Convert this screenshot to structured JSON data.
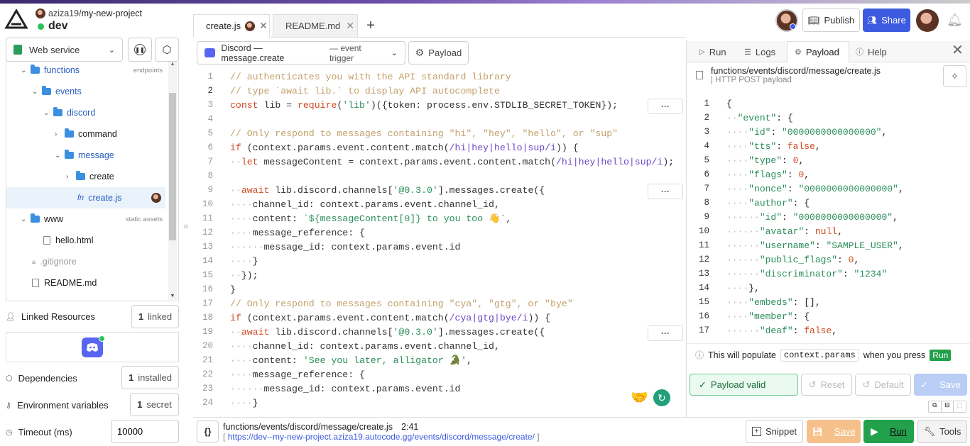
{
  "project": {
    "user": "aziza19",
    "name": "my-new-project",
    "path_sep": "/",
    "env": "dev"
  },
  "header": {
    "publish_label": "Publish",
    "share_label": "Share"
  },
  "sidebar": {
    "service_select": "Web service",
    "tree": {
      "functions": "functions",
      "functions_tag": "endpoints",
      "events": "events",
      "discord": "discord",
      "command": "command",
      "message": "message",
      "create_folder": "create",
      "create_file": "create.js",
      "www": "www",
      "www_tag": "static assets",
      "hello": "hello.html",
      "gitignore": ".gitignore",
      "readme": "README.md"
    },
    "linked_resources_label": "Linked Resources",
    "linked_count": "1",
    "linked_suffix": "linked",
    "dependencies_label": "Dependencies",
    "dep_count": "1",
    "dep_suffix": "installed",
    "env_label": "Environment variables",
    "env_count": "1",
    "env_suffix": "secret",
    "timeout_label": "Timeout (ms)",
    "timeout_value": "10000"
  },
  "tabs": [
    {
      "label": "create.js"
    },
    {
      "label": "README.md"
    }
  ],
  "trigger": {
    "name": "Discord — message.create",
    "kind": "— event trigger",
    "payload_label": "Payload"
  },
  "code": [
    {
      "n": "1",
      "t": "// authenticates you with the API standard library"
    },
    {
      "n": "2",
      "t": "// type `await lib.` to display API autocomplete"
    },
    {
      "n": "3",
      "t": "const lib = require('lib')({token: process.env.STDLIB_SECRET_TOKEN});"
    },
    {
      "n": "4",
      "t": ""
    },
    {
      "n": "5",
      "t": "// Only respond to messages containing \"hi\", \"hey\", \"hello\", or \"sup\""
    },
    {
      "n": "6",
      "t": "if (context.params.event.content.match(/hi|hey|hello|sup/i)) {"
    },
    {
      "n": "7",
      "t": "··let messageContent = context.params.event.content.match(/hi|hey|hello|sup/i);"
    },
    {
      "n": "8",
      "t": ""
    },
    {
      "n": "9",
      "t": "··await lib.discord.channels['@0.3.0'].messages.create({"
    },
    {
      "n": "10",
      "t": "····channel_id: context.params.event.channel_id,"
    },
    {
      "n": "11",
      "t": "····content: `${messageContent[0]} to you too 👋`,"
    },
    {
      "n": "12",
      "t": "····message_reference: {"
    },
    {
      "n": "13",
      "t": "······message_id: context.params.event.id"
    },
    {
      "n": "14",
      "t": "····}"
    },
    {
      "n": "15",
      "t": "··});"
    },
    {
      "n": "16",
      "t": "}"
    },
    {
      "n": "17",
      "t": "// Only respond to messages containing \"cya\", \"gtg\", or \"bye\""
    },
    {
      "n": "18",
      "t": "if (context.params.event.content.match(/cya|gtg|bye/i)) {"
    },
    {
      "n": "19",
      "t": "··await lib.discord.channels['@0.3.0'].messages.create({"
    },
    {
      "n": "20",
      "t": "····channel_id: context.params.event.channel_id,"
    },
    {
      "n": "21",
      "t": "····content: 'See you later, alligator 🐊',"
    },
    {
      "n": "22",
      "t": "····message_reference: {"
    },
    {
      "n": "23",
      "t": "······message_id: context.params.event.id"
    },
    {
      "n": "24",
      "t": "····}"
    }
  ],
  "right_tabs": {
    "run": "Run",
    "logs": "Logs",
    "payload": "Payload",
    "help": "Help"
  },
  "payload_file": {
    "path": "functions/events/discord/message/create.js",
    "method": "| HTTP POST payload"
  },
  "json_lines": [
    {
      "n": "1",
      "t": "{"
    },
    {
      "n": "2",
      "t": "··\"event\": {"
    },
    {
      "n": "3",
      "t": "····\"id\": \"0000000000000000\","
    },
    {
      "n": "4",
      "t": "····\"tts\": false,"
    },
    {
      "n": "5",
      "t": "····\"type\": 0,"
    },
    {
      "n": "6",
      "t": "····\"flags\": 0,"
    },
    {
      "n": "7",
      "t": "····\"nonce\": \"0000000000000000\","
    },
    {
      "n": "8",
      "t": "····\"author\": {"
    },
    {
      "n": "9",
      "t": "······\"id\": \"0000000000000000\","
    },
    {
      "n": "10",
      "t": "······\"avatar\": null,"
    },
    {
      "n": "11",
      "t": "······\"username\": \"SAMPLE_USER\","
    },
    {
      "n": "12",
      "t": "······\"public_flags\": 0,"
    },
    {
      "n": "13",
      "t": "······\"discriminator\": \"1234\""
    },
    {
      "n": "14",
      "t": "····},"
    },
    {
      "n": "15",
      "t": "····\"embeds\": [],"
    },
    {
      "n": "16",
      "t": "····\"member\": {"
    },
    {
      "n": "17",
      "t": "······\"deaf\": false,"
    }
  ],
  "info": {
    "pre": "This will populate",
    "code": "context.params",
    "mid": "when you press",
    "run": "Run"
  },
  "payload_actions": {
    "valid": "Payload valid",
    "reset": "Reset",
    "default": "Default",
    "save": "Save"
  },
  "status": {
    "file": "functions/events/discord/message/create.js",
    "pos": "2:41",
    "url_pre": "[",
    "url": "https://dev--my-new-project.aziza19.autocode.gg/events/discord/message/create/",
    "url_post": "]"
  },
  "bottom": {
    "snippet": "Snippet",
    "save": "Save",
    "run": "Run",
    "tools": "Tools"
  },
  "colors": {
    "accent": "#3d5be0",
    "green": "#22a04b",
    "save_orange": "#f5c08a"
  }
}
